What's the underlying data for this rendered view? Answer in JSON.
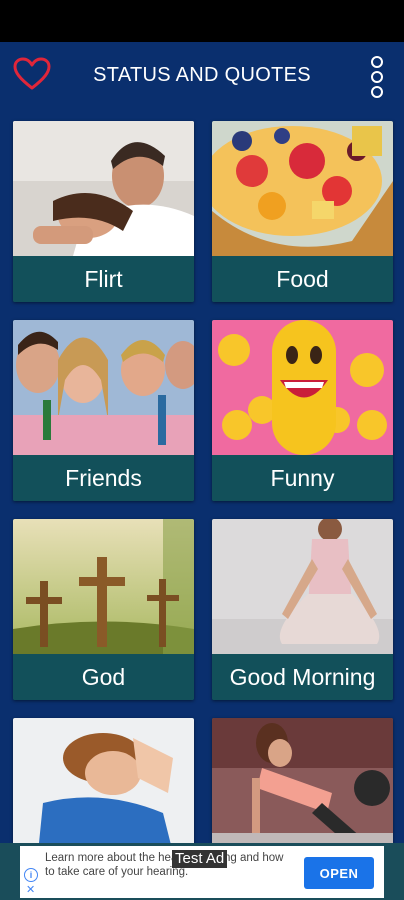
{
  "app": {
    "title": "STATUS AND QUOTES",
    "accent": "#0a2f6e",
    "label_bg": "#12505a",
    "favorite_icon": "heart-icon",
    "menu_icon": "more-vert-icon"
  },
  "categories": [
    {
      "label": "Flirt"
    },
    {
      "label": "Food"
    },
    {
      "label": "Friends"
    },
    {
      "label": "Funny"
    },
    {
      "label": "God"
    },
    {
      "label": "Good Morning"
    },
    {
      "label": ""
    },
    {
      "label": ""
    }
  ],
  "ad": {
    "text": "Learn more about the healthy hearing and how to take care of your hearing.",
    "badge": "Test Ad",
    "cta": "OPEN"
  }
}
